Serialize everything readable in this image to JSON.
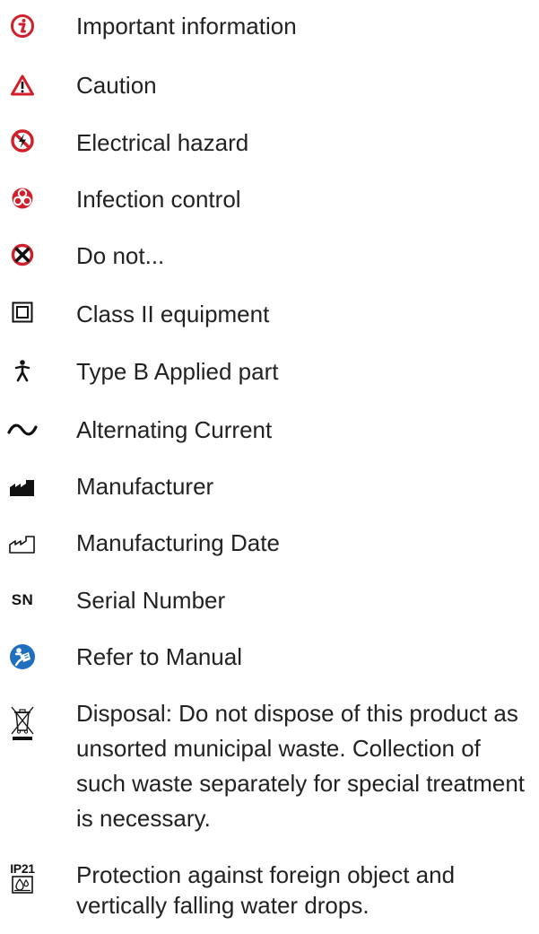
{
  "colors": {
    "accent_red": "#d0202b",
    "blue": "#1f6fbf",
    "text": "#222222"
  },
  "symbols": [
    {
      "icon": "important-information-icon",
      "label": "Important information"
    },
    {
      "icon": "caution-triangle-icon",
      "label": "Caution"
    },
    {
      "icon": "electrical-hazard-icon",
      "label": "Electrical hazard"
    },
    {
      "icon": "biohazard-icon",
      "label": "Infection control"
    },
    {
      "icon": "do-not-icon",
      "label": "Do not..."
    },
    {
      "icon": "class-ii-equipment-icon",
      "label": "Class II equipment"
    },
    {
      "icon": "type-b-applied-part-icon",
      "label": "Type B Applied part"
    },
    {
      "icon": "alternating-current-icon",
      "label": "Alternating Current"
    },
    {
      "icon": "manufacturer-icon",
      "label": "Manufacturer"
    },
    {
      "icon": "manufacturing-date-icon",
      "label": "Manufacturing Date"
    },
    {
      "icon": "serial-number-icon",
      "icon_text": "SN",
      "label": "Serial Number"
    },
    {
      "icon": "refer-to-manual-icon",
      "label": "Refer to Manual"
    },
    {
      "icon": "weee-disposal-icon",
      "label": "Disposal: Do not dispose of this product as unsorted municipal waste. Collection of such waste separately for special treatment is necessary."
    },
    {
      "icon": "ip21-protection-icon",
      "icon_text": "IP21",
      "label": "Protection against foreign object and vertically falling water drops."
    }
  ]
}
